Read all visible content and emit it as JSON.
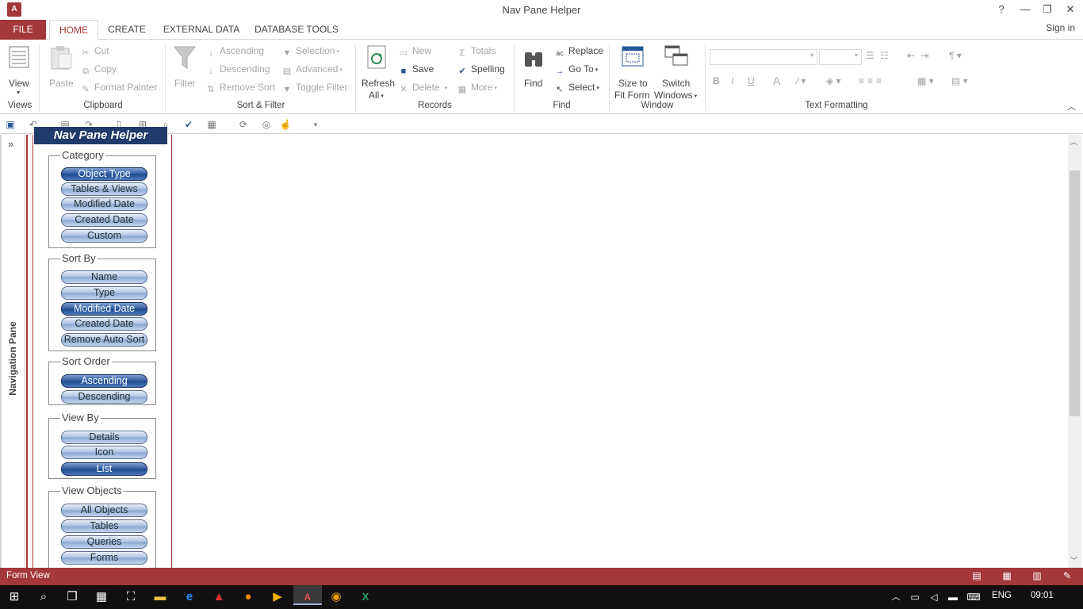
{
  "window": {
    "title": "Nav Pane Helper",
    "app_icon": "A",
    "help": "?",
    "minimize": "—",
    "restore": "❐",
    "close": "✕"
  },
  "ribbon_tabs": [
    "FILE",
    "HOME",
    "CREATE",
    "EXTERNAL DATA",
    "DATABASE TOOLS"
  ],
  "sign_in": "Sign in",
  "ribbon": {
    "views": {
      "view": "View",
      "label": "Views"
    },
    "clipboard": {
      "paste": "Paste",
      "cut": "Cut",
      "copy": "Copy",
      "format_painter": "Format Painter",
      "label": "Clipboard"
    },
    "sort_filter": {
      "filter": "Filter",
      "ascending": "Ascending",
      "descending": "Descending",
      "remove_sort": "Remove Sort",
      "selection": "Selection",
      "advanced": "Advanced",
      "toggle_filter": "Toggle Filter",
      "label": "Sort & Filter"
    },
    "records": {
      "refresh": "Refresh",
      "refresh_all": "All",
      "new": "New",
      "save": "Save",
      "delete": "Delete",
      "totals": "Totals",
      "spelling": "Spelling",
      "more": "More",
      "label": "Records"
    },
    "find": {
      "find": "Find",
      "replace": "Replace",
      "goto": "Go To",
      "select": "Select",
      "label": "Find"
    },
    "window": {
      "size_to_fit": "Size to",
      "size_to_fit2": "Fit Form",
      "switch": "Switch",
      "switch2": "Windows",
      "label": "Window"
    },
    "text_formatting": {
      "bold": "B",
      "italic": "I",
      "underline": "U",
      "font_color": "A",
      "label": "Text Formatting"
    }
  },
  "nav_pane": {
    "label": "Navigation Pane",
    "toggle": "»"
  },
  "form": {
    "title": "Nav Pane Helper",
    "groups": [
      {
        "title": "Category",
        "buttons": [
          "Object Type",
          "Tables & Views",
          "Modified Date",
          "Created Date",
          "Custom"
        ],
        "selected": 0
      },
      {
        "title": "Sort By",
        "buttons": [
          "Name",
          "Type",
          "Modified Date",
          "Created Date",
          "Remove Auto Sort"
        ],
        "selected": 2
      },
      {
        "title": "Sort Order",
        "buttons": [
          "Ascending",
          "Descending"
        ],
        "selected": 0
      },
      {
        "title": "View By",
        "buttons": [
          "Details",
          "Icon",
          "List"
        ],
        "selected": 2
      },
      {
        "title": "View Objects",
        "buttons": [
          "All Objects",
          "Tables",
          "Queries",
          "Forms"
        ],
        "selected": -1
      }
    ]
  },
  "status": {
    "text": "Form View"
  },
  "taskbar": {
    "language": "ENG",
    "time": "09:01"
  },
  "colors": {
    "accent": "#a4373a",
    "form_title_bg": "#1f3a6b"
  }
}
